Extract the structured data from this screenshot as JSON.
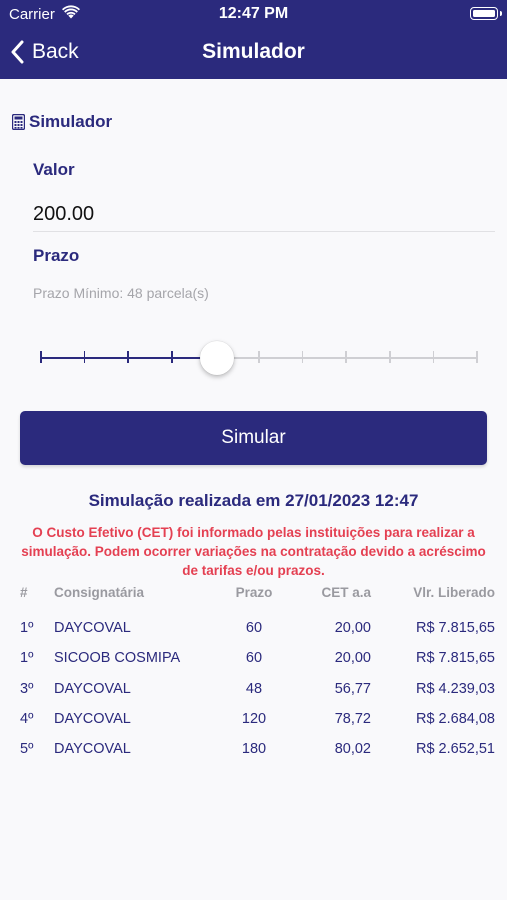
{
  "status_bar": {
    "carrier": "Carrier",
    "time": "12:47 PM"
  },
  "nav": {
    "back_label": "Back",
    "title": "Simulador"
  },
  "form": {
    "section_title": "Simulador",
    "valor_label": "Valor",
    "valor_value": "200.00",
    "prazo_label": "Prazo",
    "prazo_hint": "Prazo Mínimo: 48 parcela(s)",
    "slider": {
      "steps": 10,
      "selected_step": 4
    },
    "simulate_label": "Simular"
  },
  "results": {
    "title": "Simulação realizada em 27/01/2023 12:47",
    "disclaimer": "O Custo Efetivo (CET) foi informado pelas instituições para realizar a simulação. Podem ocorrer variações na contratação devido a acréscimo de tarifas e/ou prazos.",
    "columns": [
      "#",
      "Consignatária",
      "Prazo",
      "CET a.a",
      "Vlr. Liberado"
    ],
    "rows": [
      {
        "rank": "1º",
        "name": "DAYCOVAL",
        "prazo": "60",
        "cet": "20,00",
        "valor": "R$ 7.815,65"
      },
      {
        "rank": "1º",
        "name": "SICOOB COSMIPA",
        "prazo": "60",
        "cet": "20,00",
        "valor": "R$ 7.815,65"
      },
      {
        "rank": "3º",
        "name": "DAYCOVAL",
        "prazo": "48",
        "cet": "56,77",
        "valor": "R$ 4.239,03"
      },
      {
        "rank": "4º",
        "name": "DAYCOVAL",
        "prazo": "120",
        "cet": "78,72",
        "valor": "R$ 2.684,08"
      },
      {
        "rank": "5º",
        "name": "DAYCOVAL",
        "prazo": "180",
        "cet": "80,02",
        "valor": "R$ 2.652,51"
      }
    ]
  },
  "colors": {
    "primary": "#2b2a7d",
    "alert": "#e44052",
    "muted": "#a5a5aa",
    "background": "#f9f9fb"
  }
}
